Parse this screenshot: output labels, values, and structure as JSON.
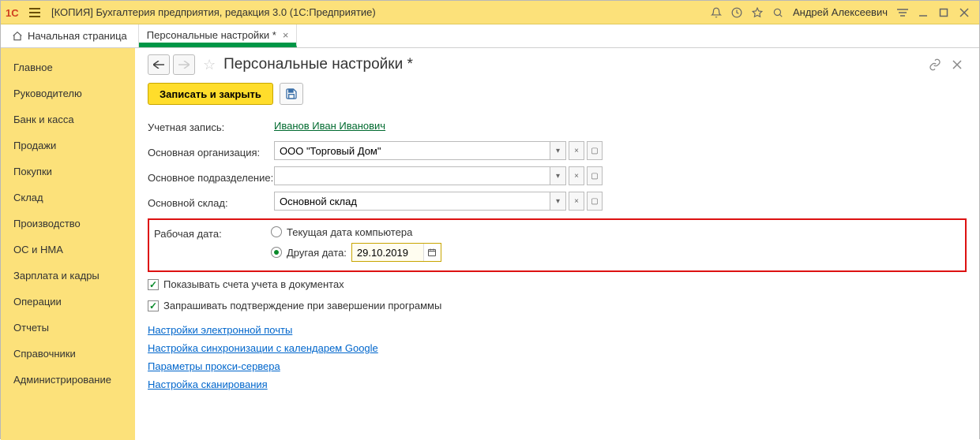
{
  "titlebar": {
    "title": "[КОПИЯ] Бухгалтерия предприятия, редакция 3.0  (1С:Предприятие)",
    "user": "Андрей Алексеевич"
  },
  "tabs": {
    "home": "Начальная страница",
    "current": "Персональные настройки *"
  },
  "sidebar": {
    "items": [
      "Главное",
      "Руководителю",
      "Банк и касса",
      "Продажи",
      "Покупки",
      "Склад",
      "Производство",
      "ОС и НМА",
      "Зарплата и кадры",
      "Операции",
      "Отчеты",
      "Справочники",
      "Администрирование"
    ]
  },
  "page": {
    "title": "Персональные настройки *",
    "save_close": "Записать и закрыть"
  },
  "form": {
    "account_label": "Учетная запись:",
    "account_value": "Иванов Иван Иванович",
    "org_label": "Основная организация:",
    "org_value": "ООО \"Торговый Дом\"",
    "dept_label": "Основное подразделение:",
    "dept_value": "",
    "warehouse_label": "Основной склад:",
    "warehouse_value": "Основной склад",
    "workdate_label": "Рабочая дата:",
    "radio_current": "Текущая дата компьютера",
    "radio_other": "Другая дата:",
    "date_value": "29.10.2019",
    "chk_accounts": "Показывать счета учета в документах",
    "chk_confirm": "Запрашивать подтверждение при завершении программы"
  },
  "links": {
    "email": "Настройки электронной почты",
    "google": "Настройка синхронизации с календарем Google",
    "proxy": "Параметры прокси-сервера",
    "scan": "Настройка сканирования"
  }
}
